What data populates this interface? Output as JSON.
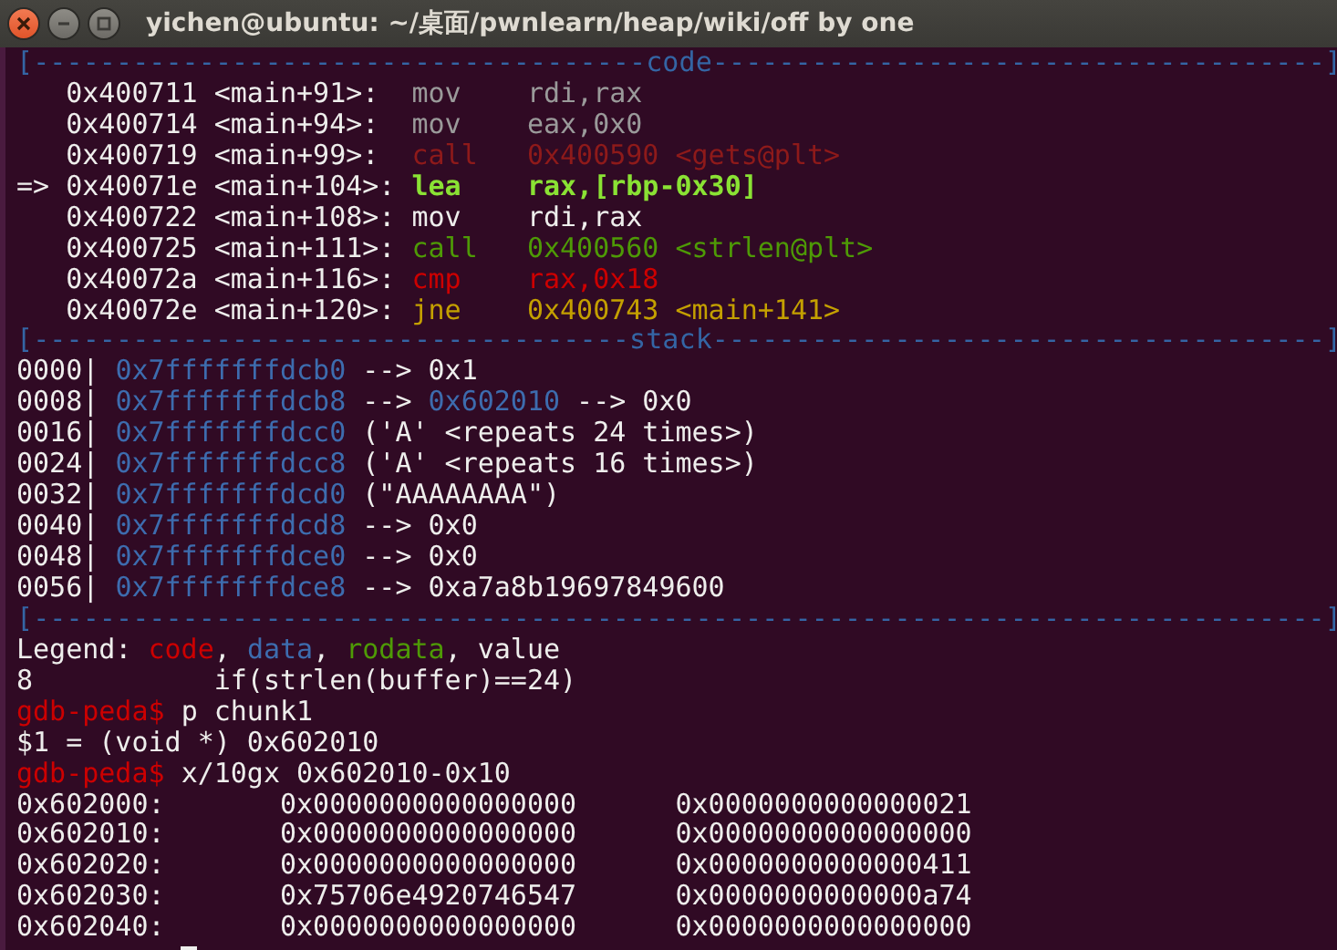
{
  "window": {
    "title": "yichen@ubuntu: ~/桌面/pwnlearn/heap/wiki/off by one"
  },
  "lines": [
    {
      "kind": "header",
      "segments": [
        {
          "text": "[-------------------------------------",
          "kind": "border"
        },
        {
          "text": "code",
          "kind": "border"
        },
        {
          "text": "-------------------------------------]",
          "kind": "border"
        }
      ]
    },
    {
      "kind": "text",
      "segments": [
        {
          "text": "   0x400711 <main+91>:  ",
          "kind": "plain"
        },
        {
          "text": "mov    rdi,rax",
          "kind": "dim"
        }
      ]
    },
    {
      "kind": "text",
      "segments": [
        {
          "text": "   0x400714 <main+94>:  ",
          "kind": "plain"
        },
        {
          "text": "mov    eax,0x0",
          "kind": "dim"
        }
      ]
    },
    {
      "kind": "text",
      "segments": [
        {
          "text": "   0x400719 <main+99>:  ",
          "kind": "plain"
        },
        {
          "text": "call   0x400590 <gets@plt>",
          "kind": "dimcode"
        }
      ]
    },
    {
      "kind": "text",
      "segments": [
        {
          "text": "=> 0x40071e <main+104>: ",
          "kind": "plain"
        },
        {
          "text": "lea    rax,[rbp-0x30]",
          "kind": "current"
        }
      ]
    },
    {
      "kind": "text",
      "segments": [
        {
          "text": "   0x400722 <main+108>: mov    rdi,rax",
          "kind": "plain"
        }
      ]
    },
    {
      "kind": "text",
      "segments": [
        {
          "text": "   0x400725 <main+111>: ",
          "kind": "plain"
        },
        {
          "text": "call   0x400560 <strlen@plt>",
          "kind": "rodata"
        }
      ]
    },
    {
      "kind": "text",
      "segments": [
        {
          "text": "   0x40072a <main+116>: ",
          "kind": "plain"
        },
        {
          "text": "cmp    rax,0x18",
          "kind": "code"
        }
      ]
    },
    {
      "kind": "text",
      "segments": [
        {
          "text": "   0x40072e <main+120>: ",
          "kind": "plain"
        },
        {
          "text": "jne    0x400743 <main+141>",
          "kind": "jump"
        }
      ]
    },
    {
      "kind": "header",
      "segments": [
        {
          "text": "[------------------------------------",
          "kind": "border"
        },
        {
          "text": "stack",
          "kind": "border"
        },
        {
          "text": "-------------------------------------]",
          "kind": "border"
        }
      ]
    },
    {
      "kind": "text",
      "segments": [
        {
          "text": "0000| ",
          "kind": "plain"
        },
        {
          "text": "0x7fffffffdcb0",
          "kind": "data"
        },
        {
          "text": " --> 0x1",
          "kind": "plain"
        }
      ]
    },
    {
      "kind": "text",
      "segments": [
        {
          "text": "0008| ",
          "kind": "plain"
        },
        {
          "text": "0x7fffffffdcb8",
          "kind": "data"
        },
        {
          "text": " --> ",
          "kind": "plain"
        },
        {
          "text": "0x602010",
          "kind": "data"
        },
        {
          "text": " --> 0x0",
          "kind": "plain"
        }
      ]
    },
    {
      "kind": "text",
      "segments": [
        {
          "text": "0016| ",
          "kind": "plain"
        },
        {
          "text": "0x7fffffffdcc0",
          "kind": "data"
        },
        {
          "text": " ('A' <repeats 24 times>)",
          "kind": "plain"
        }
      ]
    },
    {
      "kind": "text",
      "segments": [
        {
          "text": "0024| ",
          "kind": "plain"
        },
        {
          "text": "0x7fffffffdcc8",
          "kind": "data"
        },
        {
          "text": " ('A' <repeats 16 times>)",
          "kind": "plain"
        }
      ]
    },
    {
      "kind": "text",
      "segments": [
        {
          "text": "0032| ",
          "kind": "plain"
        },
        {
          "text": "0x7fffffffdcd0",
          "kind": "data"
        },
        {
          "text": " (\"AAAAAAAA\")",
          "kind": "plain"
        }
      ]
    },
    {
      "kind": "text",
      "segments": [
        {
          "text": "0040| ",
          "kind": "plain"
        },
        {
          "text": "0x7fffffffdcd8",
          "kind": "data"
        },
        {
          "text": " --> 0x0",
          "kind": "plain"
        }
      ]
    },
    {
      "kind": "text",
      "segments": [
        {
          "text": "0048| ",
          "kind": "plain"
        },
        {
          "text": "0x7fffffffdce0",
          "kind": "data"
        },
        {
          "text": " --> 0x0",
          "kind": "plain"
        }
      ]
    },
    {
      "kind": "text",
      "segments": [
        {
          "text": "0056| ",
          "kind": "plain"
        },
        {
          "text": "0x7fffffffdce8",
          "kind": "data"
        },
        {
          "text": " --> 0xa7a8b19697849600",
          "kind": "plain"
        }
      ]
    },
    {
      "kind": "header",
      "segments": [
        {
          "text": "[------------------------------------------------------------------------------]",
          "kind": "border"
        }
      ]
    },
    {
      "kind": "text",
      "segments": [
        {
          "text": "Legend: ",
          "kind": "plain"
        },
        {
          "text": "code",
          "kind": "code"
        },
        {
          "text": ", ",
          "kind": "plain"
        },
        {
          "text": "data",
          "kind": "data"
        },
        {
          "text": ", ",
          "kind": "plain"
        },
        {
          "text": "rodata",
          "kind": "rodata"
        },
        {
          "text": ", value",
          "kind": "plain"
        }
      ]
    },
    {
      "kind": "text",
      "segments": [
        {
          "text": "8           if(strlen(buffer)==24)",
          "kind": "plain"
        }
      ]
    },
    {
      "kind": "text",
      "segments": [
        {
          "text": "gdb-peda$ ",
          "kind": "code"
        },
        {
          "text": "p chunk1",
          "kind": "plain"
        }
      ]
    },
    {
      "kind": "text",
      "segments": [
        {
          "text": "$1 = (void *) 0x602010",
          "kind": "plain"
        }
      ]
    },
    {
      "kind": "text",
      "segments": [
        {
          "text": "gdb-peda$ ",
          "kind": "code"
        },
        {
          "text": "x/10gx 0x602010-0x10",
          "kind": "plain"
        }
      ]
    },
    {
      "kind": "text",
      "segments": [
        {
          "text": "0x602000:       0x0000000000000000      0x0000000000000021",
          "kind": "plain"
        }
      ]
    },
    {
      "kind": "text",
      "segments": [
        {
          "text": "0x602010:       0x0000000000000000      0x0000000000000000",
          "kind": "plain"
        }
      ]
    },
    {
      "kind": "text",
      "segments": [
        {
          "text": "0x602020:       0x0000000000000000      0x0000000000000411",
          "kind": "plain"
        }
      ]
    },
    {
      "kind": "text",
      "segments": [
        {
          "text": "0x602030:       0x75706e4920746547      0x0000000000000a74",
          "kind": "plain"
        }
      ]
    },
    {
      "kind": "text",
      "segments": [
        {
          "text": "0x602040:       0x0000000000000000      0x0000000000000000",
          "kind": "plain"
        }
      ]
    }
  ],
  "cursor": true
}
